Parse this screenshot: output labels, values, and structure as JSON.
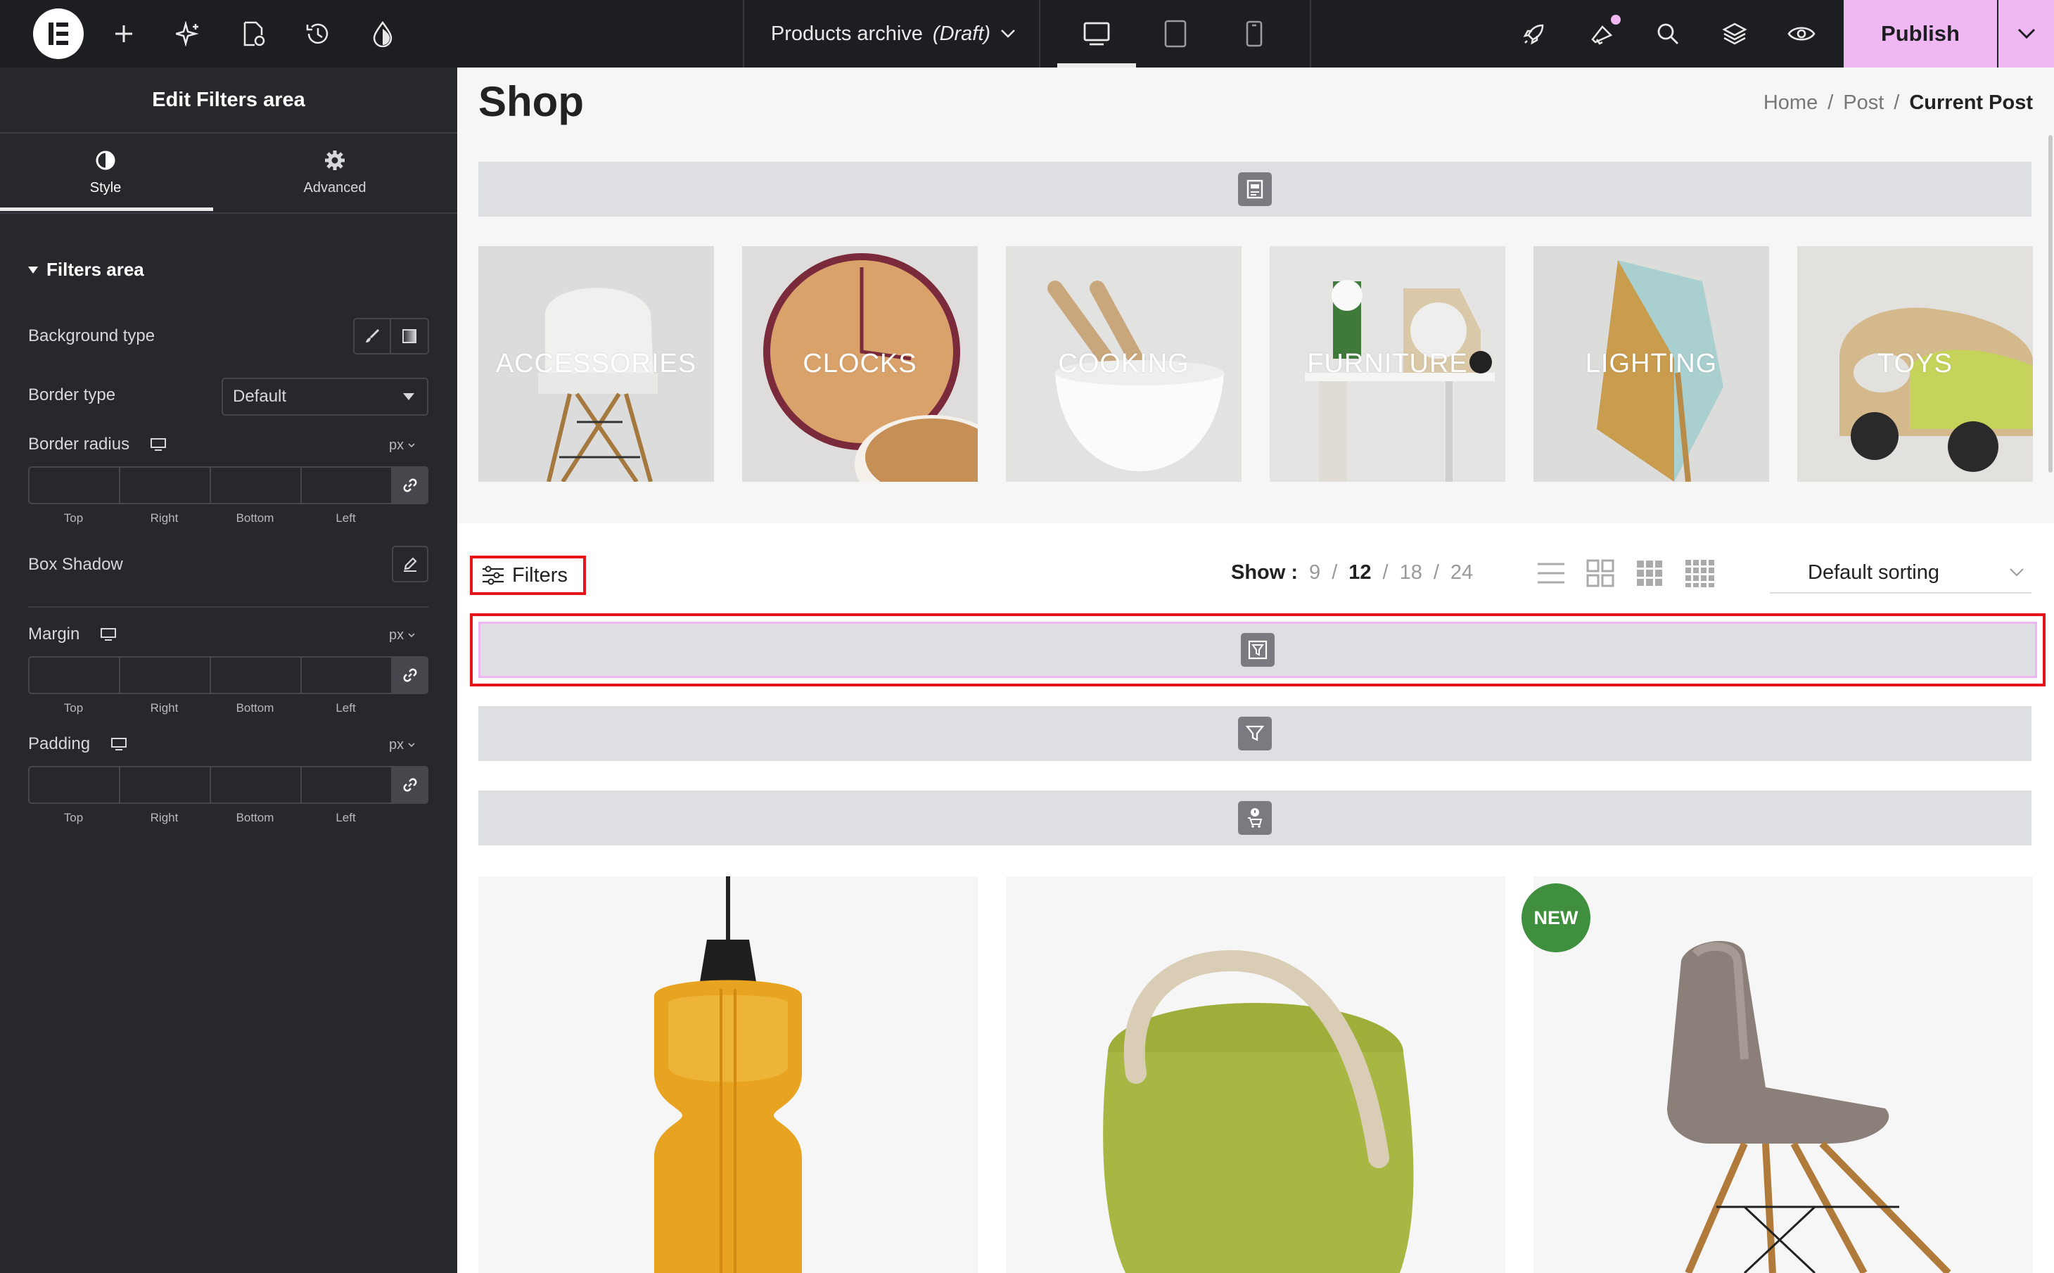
{
  "topbar": {
    "doc_name": "Products archive",
    "doc_status": "(Draft)",
    "publish_label": "Publish",
    "icons": [
      "elementor-logo-icon",
      "add-icon",
      "ai-sparkle-icon",
      "page-settings-icon",
      "history-icon",
      "theme-style-icon",
      "desktop-icon",
      "tablet-icon",
      "mobile-icon",
      "rocket-icon",
      "notifications-icon",
      "search-icon",
      "layers-icon",
      "preview-eye-icon",
      "chevron-down-icon"
    ],
    "accent_color": "#f0b8f2"
  },
  "panel": {
    "title": "Edit Filters area",
    "tabs": [
      {
        "label": "Style",
        "icon": "contrast-icon",
        "active": true
      },
      {
        "label": "Advanced",
        "icon": "gear-icon",
        "active": false
      }
    ],
    "section": "Filters area",
    "background_type_label": "Background type",
    "border_type_label": "Border type",
    "border_type_value": "Default",
    "border_radius_label": "Border radius",
    "box_shadow_label": "Box Shadow",
    "margin_label": "Margin",
    "padding_label": "Padding",
    "unit": "px",
    "dims": {
      "top": "Top",
      "right": "Right",
      "bottom": "Bottom",
      "left": "Left"
    }
  },
  "canvas": {
    "page_title": "Shop",
    "breadcrumb": {
      "home": "Home",
      "sep": "/",
      "post": "Post",
      "current": "Current Post"
    },
    "categories": [
      "ACCESSORIES",
      "CLOCKS",
      "COOKING",
      "FURNITURE",
      "LIGHTING",
      "TOYS"
    ],
    "filters_label": "Filters",
    "show": {
      "label": "Show :",
      "options": [
        "9",
        "12",
        "18",
        "24"
      ],
      "active": "12",
      "sep": "/"
    },
    "sorting_value": "Default sorting",
    "badge": "NEW",
    "highlight_color": "#e5141a"
  }
}
